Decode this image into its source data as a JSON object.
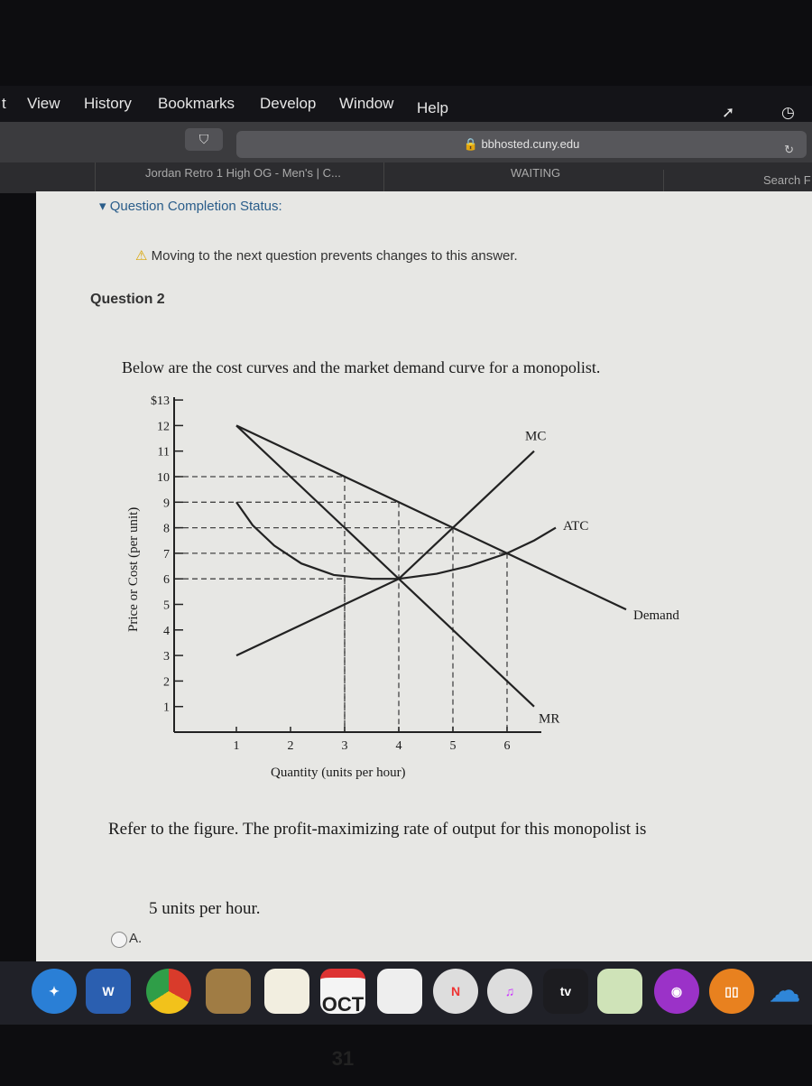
{
  "menubar": {
    "items": [
      "t",
      "View",
      "History",
      "Bookmarks",
      "Develop",
      "Window",
      "Help"
    ]
  },
  "toolbar": {
    "url": "bbhosted.cuny.edu",
    "lock_icon": "lock-icon",
    "reload_icon": "reload-icon"
  },
  "tabs": [
    {
      "label": "Jordan Retro 1 High OG - Men's | C..."
    },
    {
      "label": "WAITING"
    },
    {
      "label": "Search F"
    }
  ],
  "page": {
    "completion_status": "Question Completion Status:",
    "warning": "Moving to the next question prevents changes to this answer.",
    "question_title": "Question 2",
    "intro": "Below are the cost curves and the market demand curve for a monopolist.",
    "prompt": "Refer to the figure. The profit-maximizing rate of output for this monopolist is",
    "options": [
      {
        "letter": "A.",
        "text": "5 units per hour."
      }
    ]
  },
  "chart_data": {
    "type": "line",
    "xlabel": "Quantity (units per hour)",
    "ylabel": "Price or Cost (per unit)",
    "xlim": [
      0,
      7
    ],
    "ylim": [
      0,
      13
    ],
    "x_ticks": [
      "1",
      "2",
      "3",
      "4",
      "5",
      "6"
    ],
    "y_ticks": [
      "1",
      "2",
      "3",
      "4",
      "5",
      "6",
      "7",
      "8",
      "9",
      "10",
      "11",
      "12",
      "$13"
    ],
    "series": [
      {
        "name": "Demand",
        "points": [
          [
            1,
            12
          ],
          [
            3,
            10
          ],
          [
            4,
            9
          ],
          [
            5,
            8
          ],
          [
            6,
            7
          ],
          [
            8.2,
            4.8
          ]
        ]
      },
      {
        "name": "MR",
        "points": [
          [
            1,
            12
          ],
          [
            3,
            8
          ],
          [
            4,
            6
          ],
          [
            5,
            4
          ],
          [
            6,
            2
          ],
          [
            6.5,
            1
          ]
        ]
      },
      {
        "name": "MC",
        "points": [
          [
            1,
            3
          ],
          [
            3,
            5
          ],
          [
            4,
            6
          ],
          [
            5,
            8
          ],
          [
            6.5,
            11
          ]
        ]
      },
      {
        "name": "ATC",
        "points": [
          [
            1,
            9
          ],
          [
            1.3,
            8.1
          ],
          [
            1.7,
            7.3
          ],
          [
            2.2,
            6.6
          ],
          [
            2.8,
            6.15
          ],
          [
            3.5,
            6
          ],
          [
            4,
            6
          ],
          [
            4.7,
            6.2
          ],
          [
            5.3,
            6.5
          ],
          [
            6,
            7
          ],
          [
            6.5,
            7.5
          ],
          [
            6.9,
            8
          ]
        ]
      }
    ],
    "guides": [
      [
        3,
        10
      ],
      [
        4,
        9
      ],
      [
        5,
        8
      ],
      [
        6,
        7
      ],
      [
        3,
        6
      ]
    ],
    "grid": false
  },
  "dock": {
    "items": [
      "safari-icon",
      "W",
      "chrome-icon",
      "contacts-icon",
      "notes-icon",
      "OCT 31",
      "reminders-icon",
      "news-icon",
      "music-icon",
      "tv",
      "maps-icon",
      "podcasts-icon",
      "books-icon",
      "onedrive-icon"
    ]
  }
}
